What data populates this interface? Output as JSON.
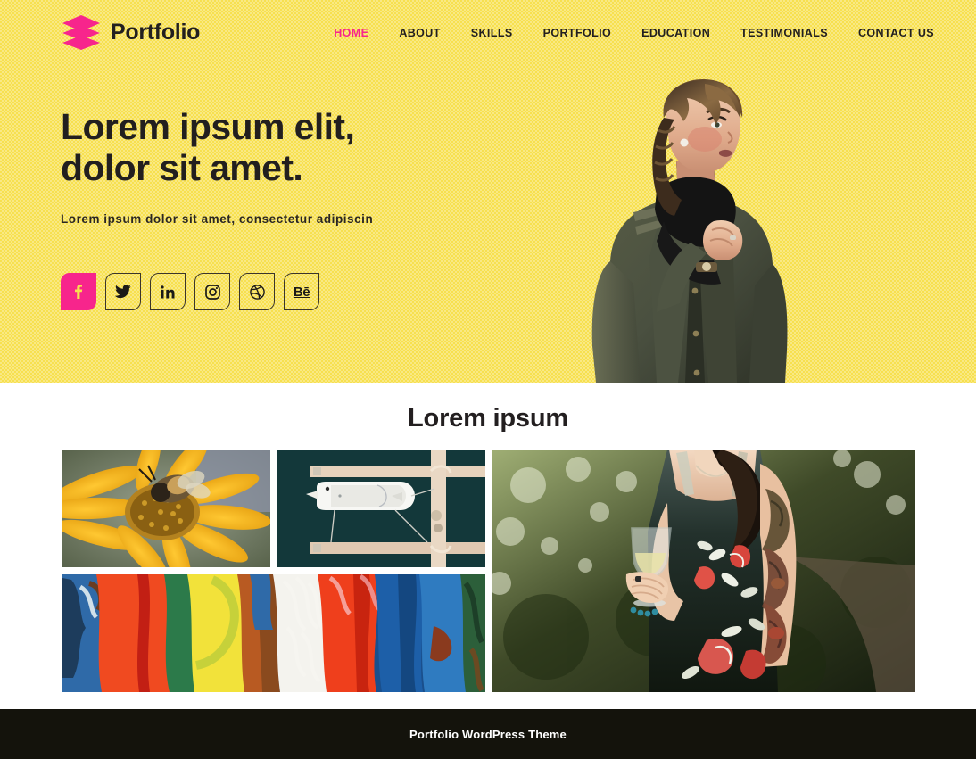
{
  "theme": {
    "hero_bg": "#f7e04f",
    "accent_pink": "#f7258c",
    "text_dark": "#221f1f",
    "footer_bg": "#14130c",
    "section_bg": "#ffffff"
  },
  "header": {
    "logo_text": "Portfolio",
    "logo_icon": "stacked-layers-icon",
    "nav": [
      {
        "label": "HOME",
        "active": true
      },
      {
        "label": "ABOUT",
        "active": false
      },
      {
        "label": "SKILLS",
        "active": false
      },
      {
        "label": "PORTFOLIO",
        "active": false
      },
      {
        "label": "EDUCATION",
        "active": false
      },
      {
        "label": "TESTIMONIALS",
        "active": false
      },
      {
        "label": "CONTACT US",
        "active": false
      }
    ]
  },
  "hero": {
    "title_line1": "Lorem ipsum elit,",
    "title_line2": "dolor sit amet.",
    "subtitle": "Lorem ipsum dolor sit amet, consectetur adipiscin",
    "photo_alt": "woman in olive jacket with black scarf",
    "social": [
      {
        "name": "facebook",
        "icon": "facebook-icon",
        "glyph": "f",
        "active": true
      },
      {
        "name": "twitter",
        "icon": "twitter-icon",
        "glyph": "",
        "active": false
      },
      {
        "name": "linkedin",
        "icon": "linkedin-icon",
        "glyph": "in",
        "active": false
      },
      {
        "name": "instagram",
        "icon": "instagram-icon",
        "glyph": "",
        "active": false
      },
      {
        "name": "dribbble",
        "icon": "dribbble-icon",
        "glyph": "",
        "active": false
      },
      {
        "name": "behance",
        "icon": "behance-icon",
        "glyph": "Bē",
        "active": false
      }
    ]
  },
  "portfolio": {
    "title": "Lorem ipsum",
    "items": [
      {
        "name": "bee-on-yellow-flower",
        "alt": "bee on a yellow daisy flower"
      },
      {
        "name": "aerial-boat-dock",
        "alt": "aerial view of white boat moored at dock"
      },
      {
        "name": "abstract-paint",
        "alt": "colorful abstract acrylic paint strokes"
      },
      {
        "name": "tattooed-woman-wine",
        "alt": "tattooed woman in floral dress holding a wine glass"
      }
    ]
  },
  "footer": {
    "text": "Portfolio WordPress Theme"
  }
}
